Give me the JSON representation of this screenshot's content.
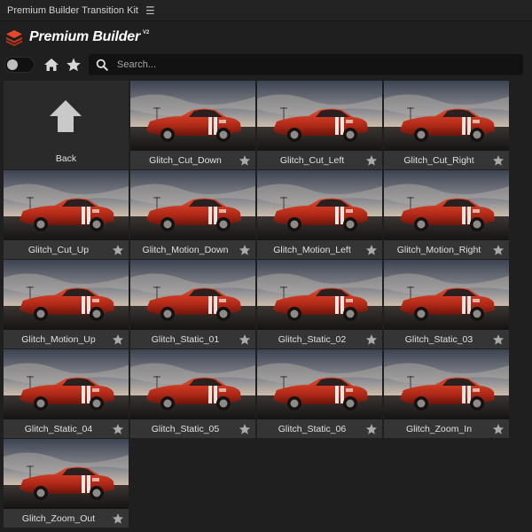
{
  "panel": {
    "title": "Premium Builder Transition Kit",
    "menu_icon": "hamburger-icon"
  },
  "brand": {
    "name": "Premium Builder",
    "version": "V2",
    "logo_icon": "layers-logo-icon",
    "accent": "#e8472a"
  },
  "toolbar": {
    "search_placeholder": "Search...",
    "toggle_on": false,
    "home_icon": "home-icon",
    "star_icon": "star-icon",
    "search_icon": "search-icon"
  },
  "back": {
    "label": "Back",
    "icon": "arrow-up-icon"
  },
  "items": [
    {
      "label": "Glitch_Cut_Down"
    },
    {
      "label": "Glitch_Cut_Left"
    },
    {
      "label": "Glitch_Cut_Right"
    },
    {
      "label": "Glitch_Cut_Up"
    },
    {
      "label": "Glitch_Motion_Down"
    },
    {
      "label": "Glitch_Motion_Left"
    },
    {
      "label": "Glitch_Motion_Right"
    },
    {
      "label": "Glitch_Motion_Up"
    },
    {
      "label": "Glitch_Static_01"
    },
    {
      "label": "Glitch_Static_02"
    },
    {
      "label": "Glitch_Static_03"
    },
    {
      "label": "Glitch_Static_04"
    },
    {
      "label": "Glitch_Static_05"
    },
    {
      "label": "Glitch_Static_06"
    },
    {
      "label": "Glitch_Zoom_In"
    },
    {
      "label": "Glitch_Zoom_Out"
    }
  ]
}
